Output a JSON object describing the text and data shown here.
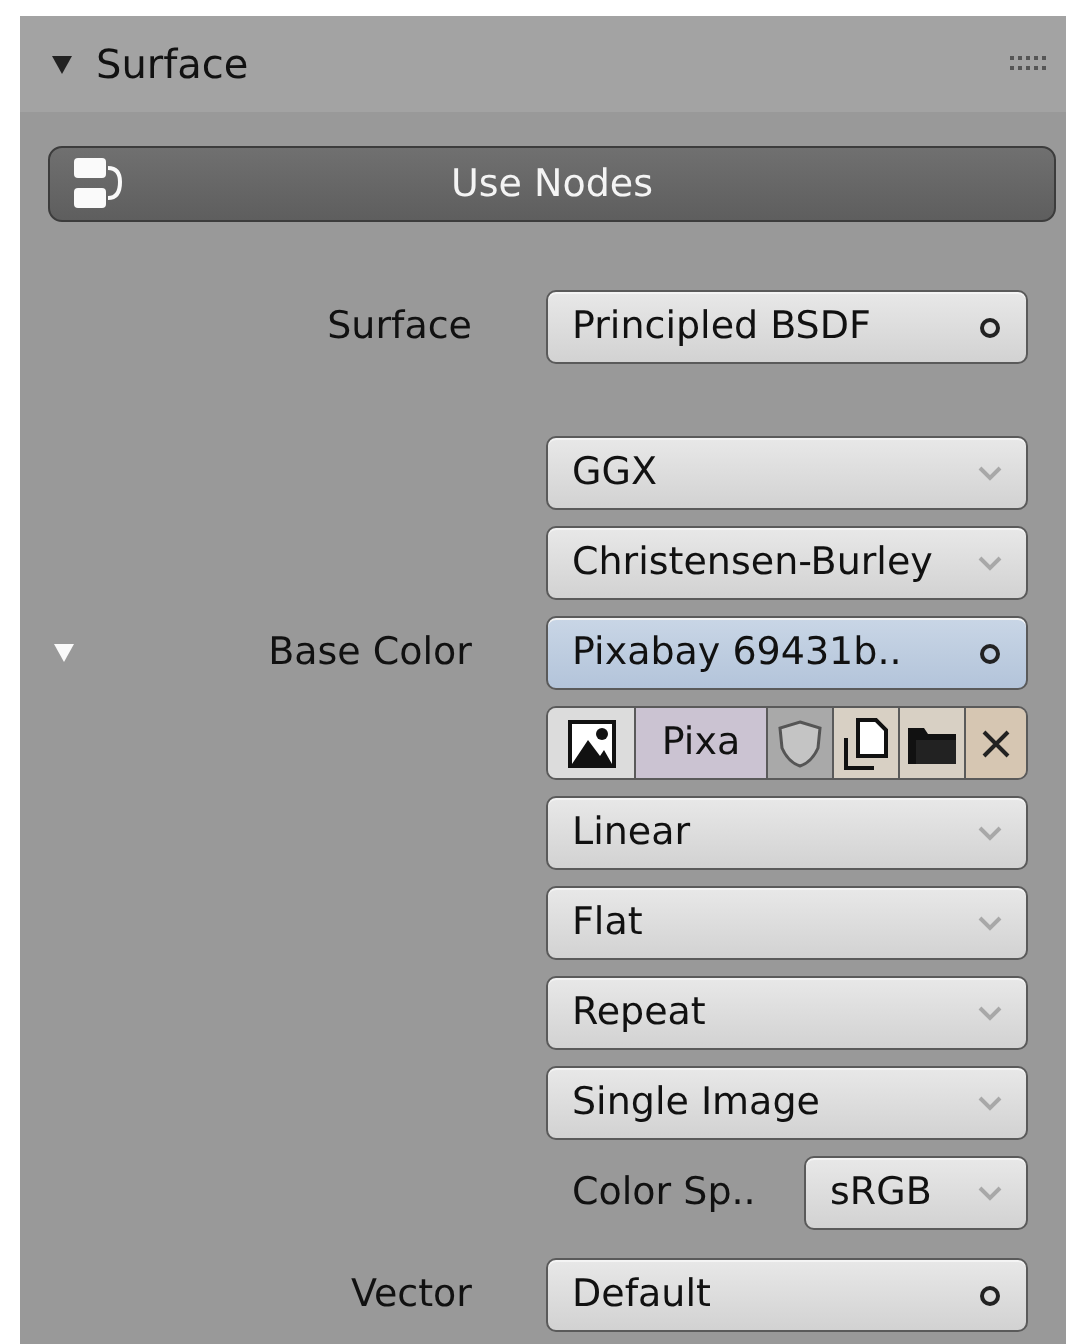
{
  "panel": {
    "title": "Surface",
    "expanded": true
  },
  "use_nodes_button": {
    "label": "Use Nodes"
  },
  "rows": [
    {
      "kind": "socket",
      "label": "Surface",
      "value": "Principled BSDF",
      "expanded": false,
      "highlighted": false
    },
    {
      "kind": "dropdown",
      "value": "GGX"
    },
    {
      "kind": "dropdown",
      "value": "Christensen-Burley"
    },
    {
      "kind": "socket",
      "label": "Base Color",
      "value": "Pixabay 69431b..",
      "expanded": true,
      "highlighted": true
    },
    {
      "kind": "image_browser",
      "name": "Pixa"
    },
    {
      "kind": "dropdown",
      "value": "Linear"
    },
    {
      "kind": "dropdown",
      "value": "Flat"
    },
    {
      "kind": "dropdown",
      "value": "Repeat"
    },
    {
      "kind": "dropdown",
      "value": "Single Image"
    },
    {
      "kind": "labeled_dropdown",
      "label": "Color Sp..",
      "value": "sRGB"
    },
    {
      "kind": "socket",
      "label": "Vector",
      "value": "Default",
      "expanded": false,
      "highlighted": false
    }
  ]
}
